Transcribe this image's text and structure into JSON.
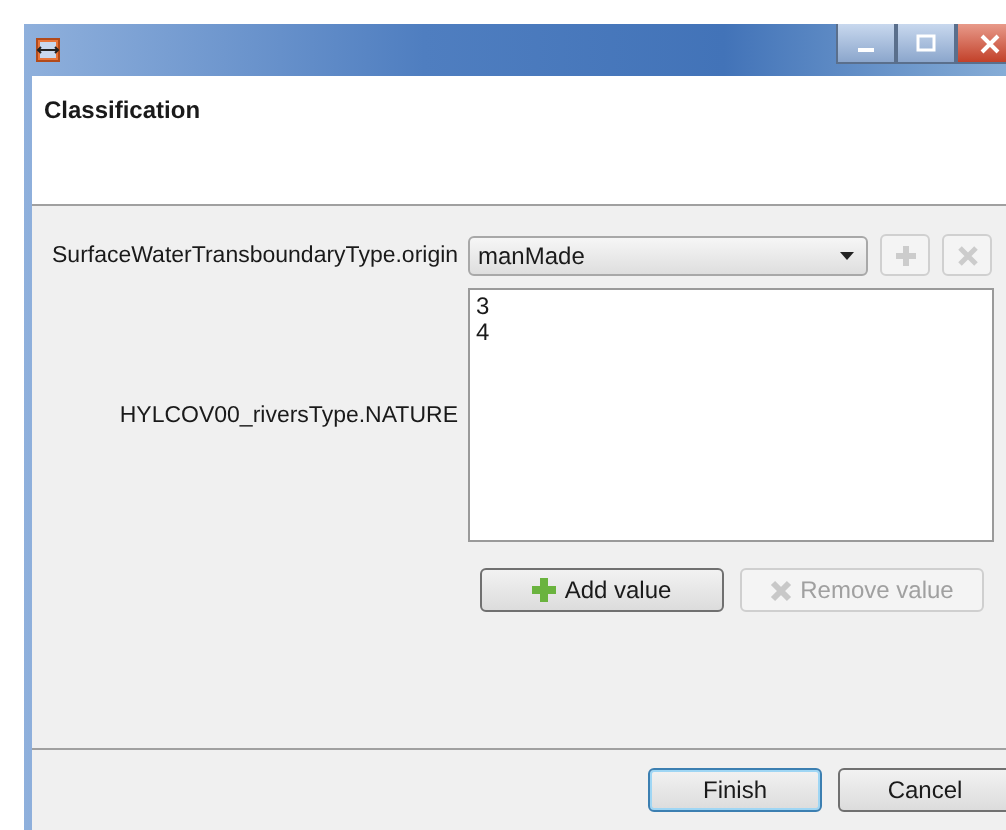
{
  "header": {
    "title": "Classification"
  },
  "fields": [
    {
      "kind": "combo",
      "label": "SurfaceWaterTransboundaryType.origin",
      "value": "manMade",
      "add_disabled": true,
      "remove_disabled": true
    },
    {
      "kind": "list",
      "label": "HYLCOV00_riversType.NATURE",
      "items": [
        "3",
        "4"
      ],
      "buttons": [
        {
          "label": "Add value",
          "disabled": false
        },
        {
          "label": "Remove value",
          "disabled": true
        }
      ]
    }
  ],
  "buttons": [
    {
      "label": "Finish",
      "default": true
    },
    {
      "label": "Cancel",
      "default": false
    }
  ]
}
